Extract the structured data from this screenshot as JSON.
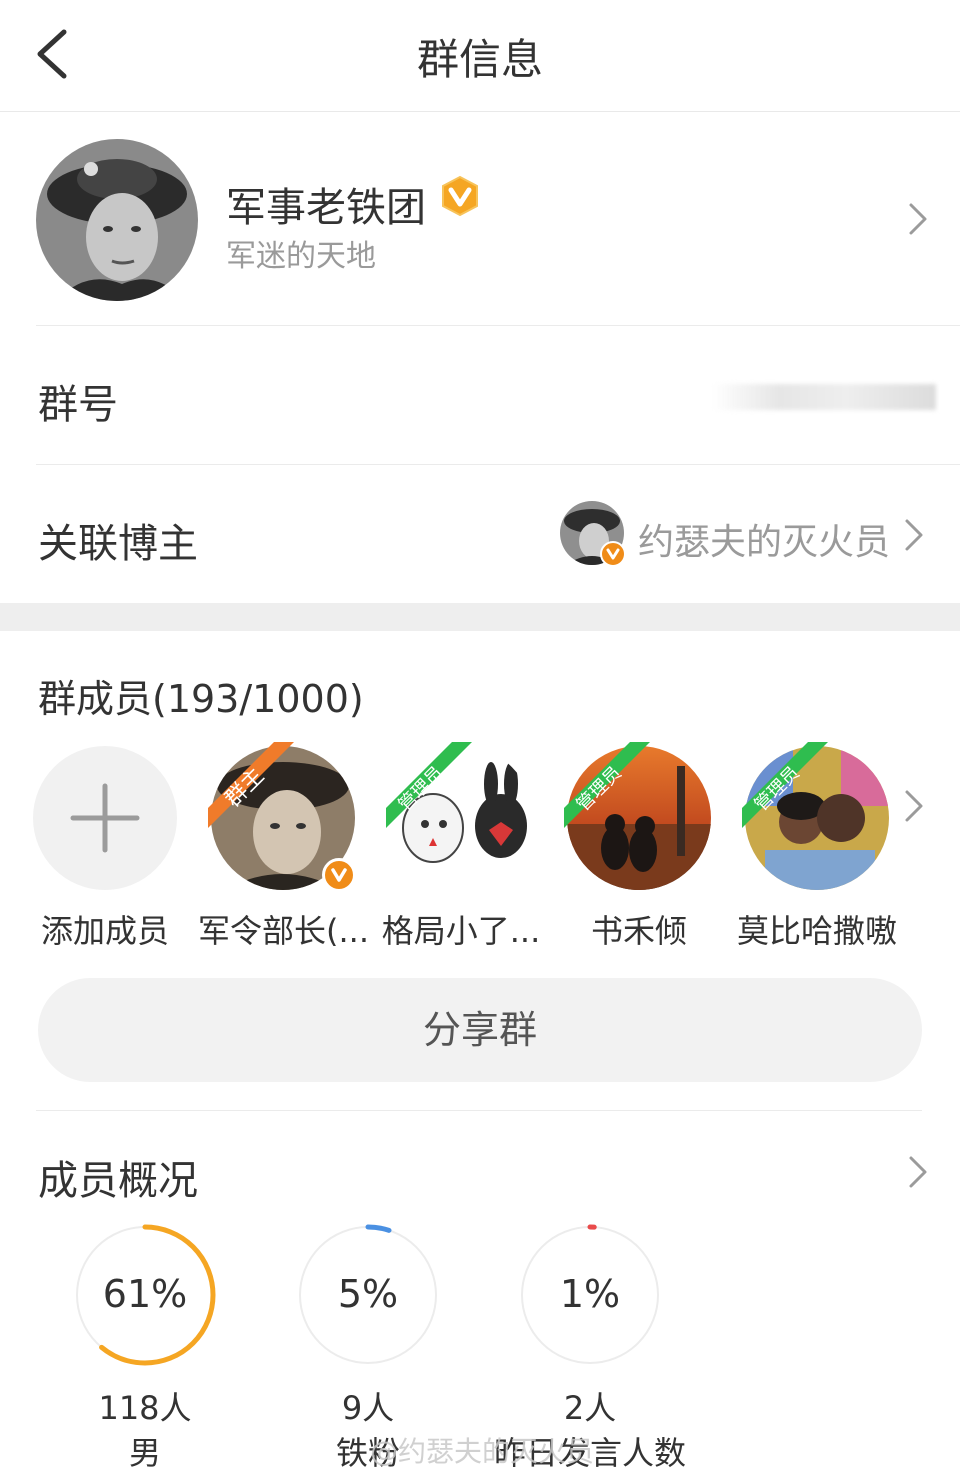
{
  "header": {
    "title": "群信息"
  },
  "group": {
    "name": "军事老铁团",
    "description": "军迷的天地"
  },
  "rows": {
    "group_number_label": "群号",
    "blogger_label": "关联博主",
    "blogger_name": "约瑟夫的灭火员"
  },
  "members": {
    "title": "群成员(193/1000)",
    "add_label": "添加成员",
    "list": [
      {
        "name": "军令部长(...",
        "role": "群主",
        "verified": true
      },
      {
        "name": "格局小了...",
        "role": "管理员"
      },
      {
        "name": "书禾倾",
        "role": "管理员"
      },
      {
        "name": "莫比哈撒嗷",
        "role": "管理员"
      }
    ]
  },
  "share_button": "分享群",
  "overview": {
    "title": "成员概况",
    "stats": [
      {
        "percent": "61%",
        "count": "118人",
        "label": "男",
        "value": 0.61,
        "color": "#f5a623"
      },
      {
        "percent": "5%",
        "count": "9人",
        "label": "铁粉",
        "value": 0.05,
        "color": "#4a90e2"
      },
      {
        "percent": "1%",
        "count": "2人",
        "label": "昨日发言人数",
        "value": 0.01,
        "color": "#e94b4b"
      }
    ]
  },
  "watermark": "@约瑟夫的灭火员",
  "colors": {
    "badge_owner": "#f07b2a",
    "badge_admin": "#2fbd4f",
    "vip": "#f5a623"
  }
}
